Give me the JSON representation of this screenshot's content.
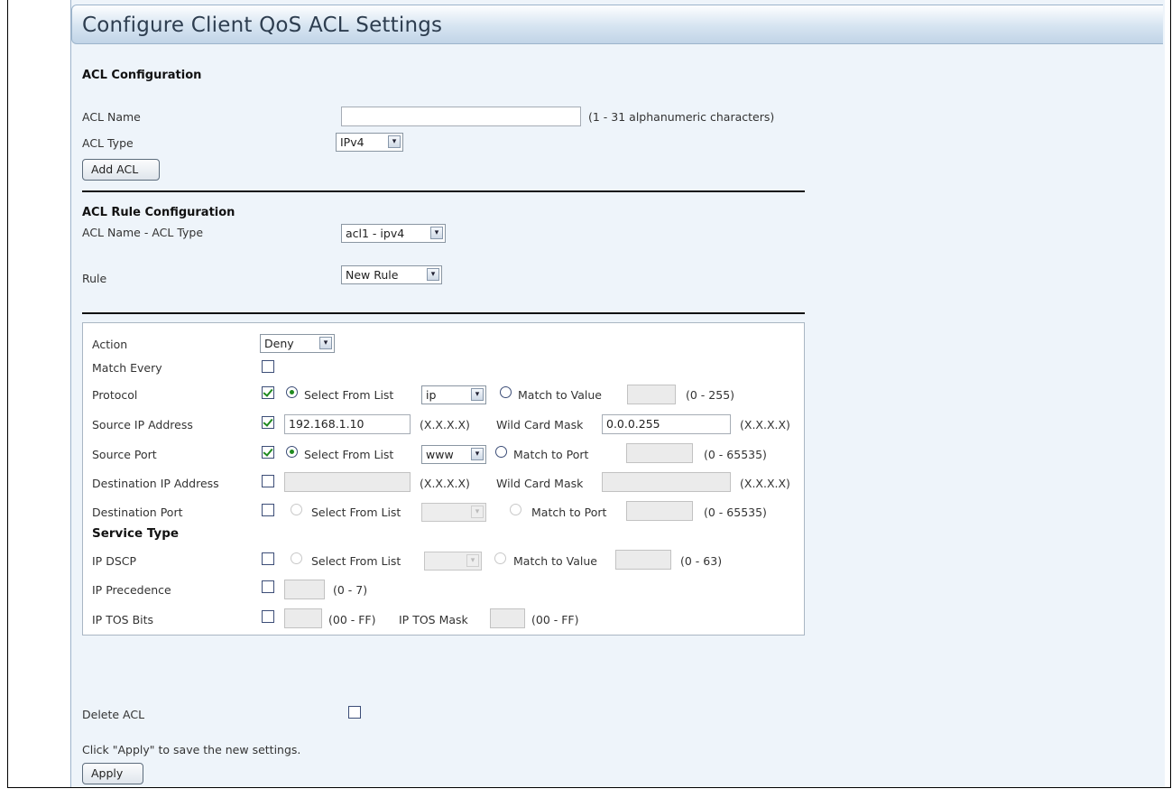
{
  "page_title": "Configure Client QoS ACL Settings",
  "acl_configuration": {
    "heading": "ACL Configuration",
    "name_label": "ACL Name",
    "name_value": "",
    "name_hint": "(1 - 31 alphanumeric characters)",
    "type_label": "ACL Type",
    "type_value": "IPv4",
    "add_button": "Add ACL"
  },
  "rule_configuration": {
    "heading": "ACL Rule Configuration",
    "name_type_label": "ACL Name - ACL Type",
    "name_type_value": "acl1 - ipv4",
    "rule_label": "Rule",
    "rule_value": "New Rule"
  },
  "rule_form": {
    "action": {
      "label": "Action",
      "value": "Deny"
    },
    "match_every": {
      "label": "Match Every",
      "checked": false
    },
    "protocol": {
      "label": "Protocol",
      "checked": true,
      "select_label": "Select From List",
      "select_value": "ip",
      "match_label": "Match to Value",
      "match_value": "",
      "range": "(0 - 255)"
    },
    "source_ip": {
      "label": "Source IP Address",
      "checked": true,
      "value": "192.168.1.10",
      "format": "(X.X.X.X)",
      "mask_label": "Wild Card Mask",
      "mask_value": "0.0.0.255",
      "mask_format": "(X.X.X.X)"
    },
    "source_port": {
      "label": "Source Port",
      "checked": true,
      "select_label": "Select From List",
      "select_value": "www",
      "match_label": "Match to Port",
      "match_value": "",
      "range": "(0 - 65535)"
    },
    "dest_ip": {
      "label": "Destination IP Address",
      "checked": false,
      "value": "",
      "format": "(X.X.X.X)",
      "mask_label": "Wild Card Mask",
      "mask_value": "",
      "mask_format": "(X.X.X.X)"
    },
    "dest_port": {
      "label": "Destination Port",
      "checked": false,
      "select_label": "Select From List",
      "select_value": "",
      "match_label": "Match to Port",
      "match_value": "",
      "range": "(0 - 65535)"
    },
    "service_type_heading": "Service Type",
    "ip_dscp": {
      "label": "IP DSCP",
      "checked": false,
      "select_label": "Select From List",
      "select_value": "",
      "match_label": "Match to Value",
      "match_value": "",
      "range": "(0 - 63)"
    },
    "ip_precedence": {
      "label": "IP Precedence",
      "checked": false,
      "value": "",
      "range": "(0 - 7)"
    },
    "ip_tos": {
      "label": "IP TOS Bits",
      "checked": false,
      "value": "",
      "range": "(00 - FF)",
      "mask_label": "IP TOS Mask",
      "mask_value": "",
      "mask_range": "(00 - FF)"
    }
  },
  "delete_acl": {
    "label": "Delete ACL",
    "checked": false
  },
  "footer": {
    "instructions": "Click \"Apply\" to save the new settings.",
    "apply_button": "Apply"
  },
  "icons": {
    "dropdown_arrow": "▾"
  }
}
